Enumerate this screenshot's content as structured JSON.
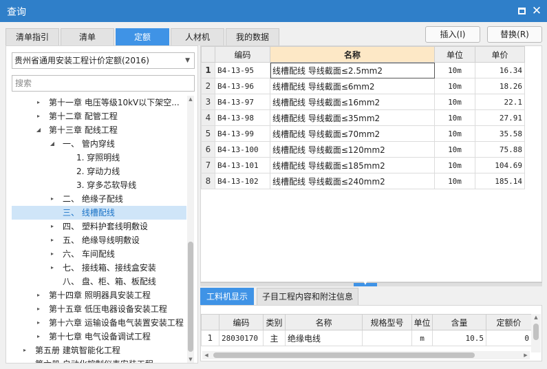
{
  "window": {
    "title": "查询"
  },
  "tabs": [
    {
      "label": "清单指引",
      "active": false
    },
    {
      "label": "清单",
      "active": false
    },
    {
      "label": "定额",
      "active": true
    },
    {
      "label": "人材机",
      "active": false
    },
    {
      "label": "我的数据",
      "active": false
    }
  ],
  "actions": {
    "insert": "插入(I)",
    "replace": "替换(R)"
  },
  "left": {
    "quota_lib": "贵州省通用安装工程计价定额(2016)",
    "search_placeholder": "搜索",
    "tree": [
      {
        "label": "第十一章 电压等级10kV以下架空...",
        "indent": 1,
        "toggle": "▸",
        "selected": false
      },
      {
        "label": "第十二章 配管工程",
        "indent": 1,
        "toggle": "▸",
        "selected": false
      },
      {
        "label": "第十三章 配线工程",
        "indent": 1,
        "toggle": "◢",
        "selected": false
      },
      {
        "label": "一、 管内穿线",
        "indent": 2,
        "toggle": "◢",
        "selected": false
      },
      {
        "label": "1. 穿照明线",
        "indent": 3,
        "toggle": "",
        "selected": false
      },
      {
        "label": "2. 穿动力线",
        "indent": 3,
        "toggle": "",
        "selected": false
      },
      {
        "label": "3. 穿多芯软导线",
        "indent": 3,
        "toggle": "",
        "selected": false
      },
      {
        "label": "二、 绝缘子配线",
        "indent": 2,
        "toggle": "▸",
        "selected": false
      },
      {
        "label": "三、 线槽配线",
        "indent": 2,
        "toggle": "",
        "selected": true
      },
      {
        "label": "四、 塑料护套线明敷设",
        "indent": 2,
        "toggle": "▸",
        "selected": false
      },
      {
        "label": "五、 绝缘导线明敷设",
        "indent": 2,
        "toggle": "▸",
        "selected": false
      },
      {
        "label": "六、 车间配线",
        "indent": 2,
        "toggle": "▸",
        "selected": false
      },
      {
        "label": "七、 接线箱、接线盒安装",
        "indent": 2,
        "toggle": "▸",
        "selected": false
      },
      {
        "label": "八、 盘、柜、箱、板配线",
        "indent": 2,
        "toggle": "",
        "selected": false
      },
      {
        "label": "第十四章 照明器具安装工程",
        "indent": 1,
        "toggle": "▸",
        "selected": false
      },
      {
        "label": "第十五章 低压电器设备安装工程",
        "indent": 1,
        "toggle": "▸",
        "selected": false
      },
      {
        "label": "第十六章 运输设备电气装置安装工程",
        "indent": 1,
        "toggle": "▸",
        "selected": false
      },
      {
        "label": "第十七章 电气设备调试工程",
        "indent": 1,
        "toggle": "▸",
        "selected": false
      },
      {
        "label": "第五册 建筑智能化工程",
        "indent": 0,
        "toggle": "▸",
        "selected": false
      },
      {
        "label": "第六册 自动化控制仪表安装工程",
        "indent": 0,
        "toggle": "▸",
        "selected": false
      }
    ]
  },
  "quota_table": {
    "headers": {
      "code": "编码",
      "name": "名称",
      "unit": "单位",
      "price": "单价"
    },
    "rows": [
      {
        "idx": "1",
        "code": "B4-13-95",
        "name": "线槽配线 导线截面≤2.5mm2",
        "unit": "10m",
        "price": "16.34"
      },
      {
        "idx": "2",
        "code": "B4-13-96",
        "name": "线槽配线 导线截面≤6mm2",
        "unit": "10m",
        "price": "18.26"
      },
      {
        "idx": "3",
        "code": "B4-13-97",
        "name": "线槽配线 导线截面≤16mm2",
        "unit": "10m",
        "price": "22.1"
      },
      {
        "idx": "4",
        "code": "B4-13-98",
        "name": "线槽配线 导线截面≤35mm2",
        "unit": "10m",
        "price": "27.91"
      },
      {
        "idx": "5",
        "code": "B4-13-99",
        "name": "线槽配线 导线截面≤70mm2",
        "unit": "10m",
        "price": "35.58"
      },
      {
        "idx": "6",
        "code": "B4-13-100",
        "name": "线槽配线 导线截面≤120mm2",
        "unit": "10m",
        "price": "75.88"
      },
      {
        "idx": "7",
        "code": "B4-13-101",
        "name": "线槽配线 导线截面≤185mm2",
        "unit": "10m",
        "price": "104.69"
      },
      {
        "idx": "8",
        "code": "B4-13-102",
        "name": "线槽配线 导线截面≤240mm2",
        "unit": "10m",
        "price": "185.14"
      }
    ]
  },
  "bottom_tabs": [
    {
      "label": "工料机显示",
      "active": true
    },
    {
      "label": "子目工程内容和附注信息",
      "active": false
    }
  ],
  "material_table": {
    "headers": {
      "code": "编码",
      "category": "类别",
      "name": "名称",
      "spec": "规格型号",
      "unit": "单位",
      "qty": "含量",
      "price": "定额价"
    },
    "rows": [
      {
        "idx": "1",
        "code": "28030170",
        "category": "主",
        "name": "绝缘电线",
        "spec": "",
        "unit": "m",
        "qty": "10.5",
        "price": "0"
      }
    ]
  }
}
